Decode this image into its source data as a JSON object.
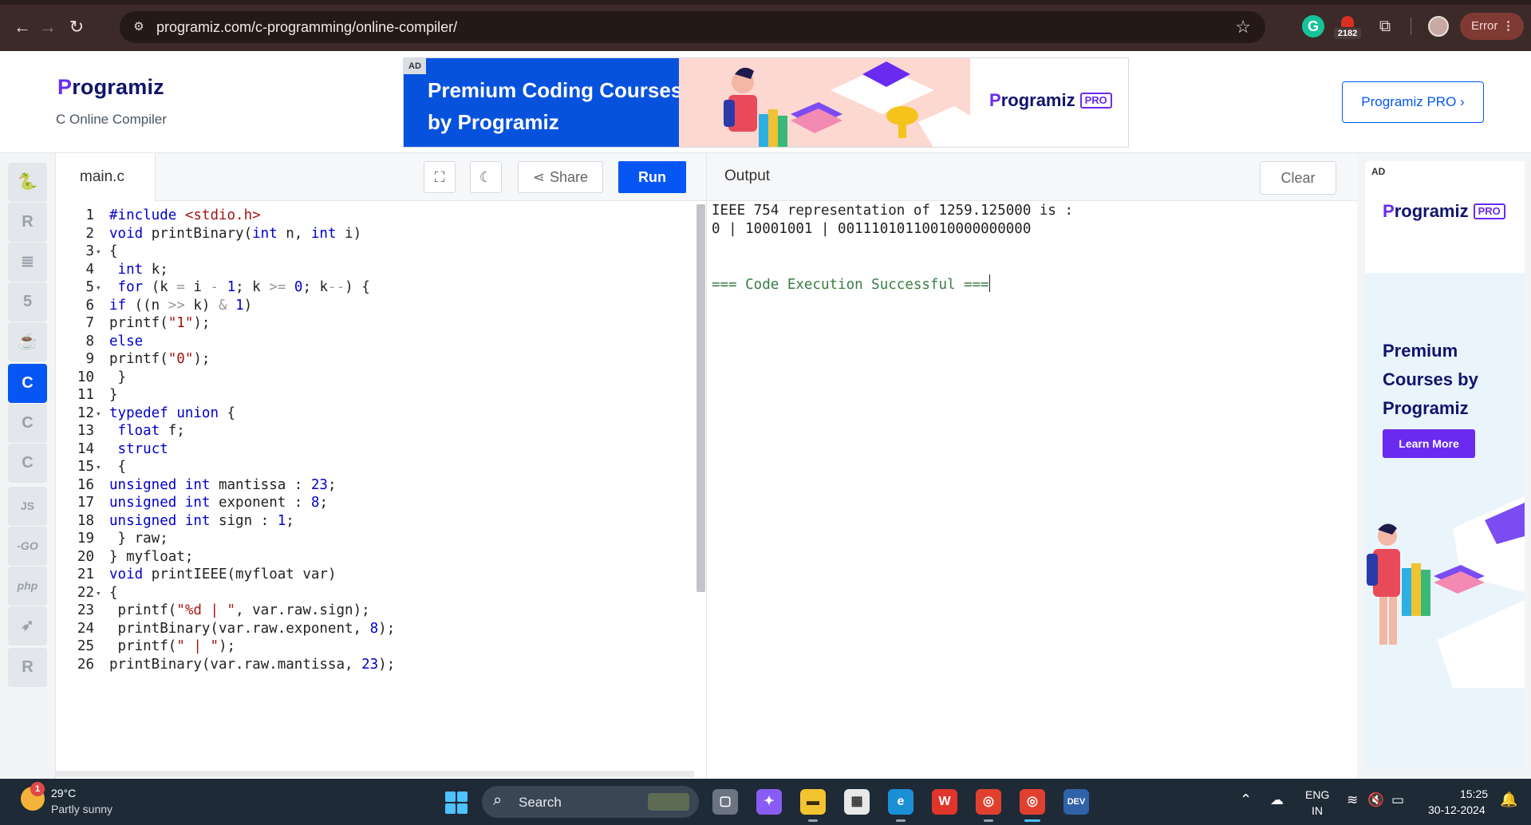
{
  "browser": {
    "url": "programiz.com/c-programming/online-compiler/",
    "extension_badge": "2182",
    "profile_status": "Error",
    "icons": [
      "back-icon",
      "forward-icon",
      "reload-icon",
      "site-settings-icon",
      "star-icon",
      "grammarly-icon",
      "extension-icon",
      "puzzle-icon",
      "profile-icon",
      "menu-icon"
    ]
  },
  "header": {
    "logo_first": "P",
    "logo_rest": "rogramiz",
    "subtitle": "C Online Compiler",
    "ad_tag": "AD",
    "ad_title": "Premium Coding Courses by Programiz",
    "ad_brand_first": "P",
    "ad_brand_rest": "rogramiz",
    "ad_pro": "PRO",
    "pro_button": "Programiz PRO ›"
  },
  "rail": {
    "items": [
      {
        "icon": "python-icon",
        "glyph": "🐍"
      },
      {
        "icon": "r-icon",
        "glyph": "R"
      },
      {
        "icon": "sql-icon",
        "glyph": "≣"
      },
      {
        "icon": "html-icon",
        "glyph": "5"
      },
      {
        "icon": "java-icon",
        "glyph": "☕"
      },
      {
        "icon": "c-icon",
        "glyph": "C"
      },
      {
        "icon": "cpp-icon",
        "glyph": "C"
      },
      {
        "icon": "csharp-icon",
        "glyph": "C"
      },
      {
        "icon": "js-icon",
        "glyph": "JS"
      },
      {
        "icon": "go-icon",
        "glyph": "-GO"
      },
      {
        "icon": "php-icon",
        "glyph": "php"
      },
      {
        "icon": "swift-icon",
        "glyph": "➶"
      },
      {
        "icon": "rust-icon",
        "glyph": "R"
      }
    ]
  },
  "editor": {
    "file_name": "main.c",
    "share_label": "Share",
    "run_label": "Run",
    "lines": [
      "1",
      "2",
      "3",
      "4",
      "5",
      "6",
      "7",
      "8",
      "9",
      "10",
      "11",
      "12",
      "13",
      "14",
      "15",
      "16",
      "17",
      "18",
      "19",
      "20",
      "21",
      "22",
      "23",
      "24",
      "25",
      "26"
    ]
  },
  "output": {
    "title": "Output",
    "clear_label": "Clear",
    "line1": "IEEE 754 representation of 1259.125000 is :",
    "line2": "0 | 10001001 | 00111010110010000000000",
    "success": "=== Code Execution Successful ==="
  },
  "side_ad": {
    "tag": "AD",
    "brand_first": "P",
    "brand_rest": "rogramiz",
    "pro": "PRO",
    "headline": "Premium Courses by Programiz",
    "cta": "Learn More"
  },
  "taskbar": {
    "weather_badge": "1",
    "temperature": "29°C",
    "weather": "Partly sunny",
    "search_label": "Search",
    "lang_top": "ENG",
    "lang_bottom": "IN",
    "time": "15:25",
    "date": "30-12-2024"
  },
  "colors": {
    "accent": "#0556f3",
    "brand_purple": "#6a2bf1",
    "brand_navy": "#10146b",
    "chrome_bg": "#3c2a28",
    "success_green": "#3a7d44"
  }
}
